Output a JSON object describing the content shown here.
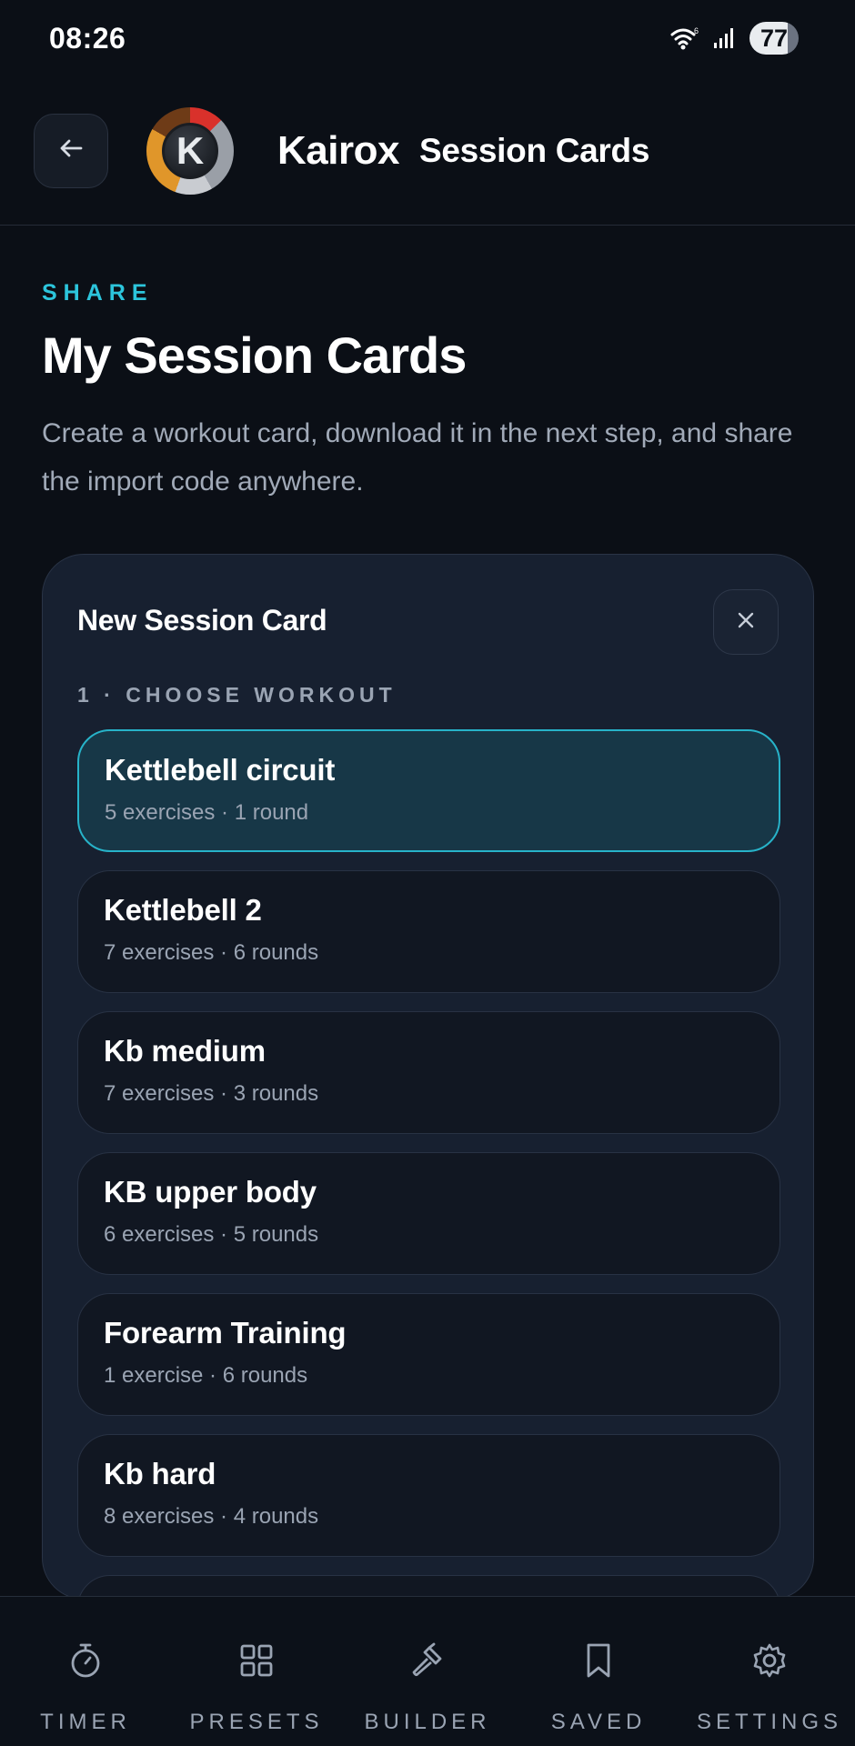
{
  "status_bar": {
    "time": "08:26",
    "battery": "77",
    "icons": [
      "wifi-icon",
      "signal-icon",
      "battery-icon"
    ]
  },
  "header": {
    "brand": "Kairox",
    "title": "Session Cards",
    "back_icon": "arrow-left-icon",
    "logo_letter": "K"
  },
  "intro": {
    "eyebrow": "SHARE",
    "title": "My Session Cards",
    "description": "Create a workout card, download it in the next step, and share the import code anywhere."
  },
  "card": {
    "title": "New Session Card",
    "close_icon": "close-icon",
    "step_label": "1 · CHOOSE WORKOUT",
    "workouts": [
      {
        "name": "Kettlebell circuit",
        "meta": "5 exercises · 1 round",
        "selected": true
      },
      {
        "name": "Kettlebell 2",
        "meta": "7 exercises · 6 rounds",
        "selected": false
      },
      {
        "name": "Kb medium",
        "meta": "7 exercises · 3 rounds",
        "selected": false
      },
      {
        "name": "KB upper body",
        "meta": "6 exercises · 5 rounds",
        "selected": false
      },
      {
        "name": "Forearm Training",
        "meta": "1 exercise · 6 rounds",
        "selected": false
      },
      {
        "name": "Kb hard",
        "meta": "8 exercises · 4 rounds",
        "selected": false
      },
      {
        "name": "",
        "meta": "",
        "selected": false
      }
    ]
  },
  "nav": {
    "items": [
      {
        "label": "TIMER",
        "icon": "stopwatch-icon"
      },
      {
        "label": "PRESETS",
        "icon": "grid-icon"
      },
      {
        "label": "BUILDER",
        "icon": "hammer-icon"
      },
      {
        "label": "SAVED",
        "icon": "bookmark-icon"
      },
      {
        "label": "SETTINGS",
        "icon": "gear-icon"
      }
    ]
  },
  "colors": {
    "accent": "#2cc5dc",
    "background": "#0b0f16",
    "card": "#172030",
    "selected_item": "#173747"
  }
}
